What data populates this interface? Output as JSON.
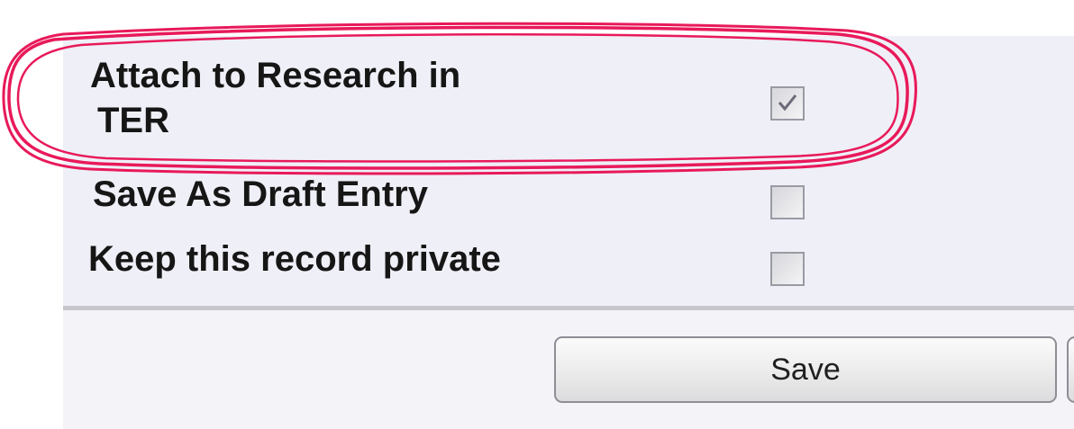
{
  "options": [
    {
      "label_line1": "Attach to Research in",
      "label_line2": "TER",
      "checked": true
    },
    {
      "label": "Save As Draft Entry",
      "checked": false
    },
    {
      "label": "Keep this record private",
      "checked": false
    }
  ],
  "actions": {
    "save_label": "Save"
  },
  "colors": {
    "panel_background": "#efeff7",
    "highlight_annotation": "#e8195a"
  },
  "annotation": {
    "type": "freehand-ellipse",
    "highlights": "Attach to Research in TER"
  }
}
